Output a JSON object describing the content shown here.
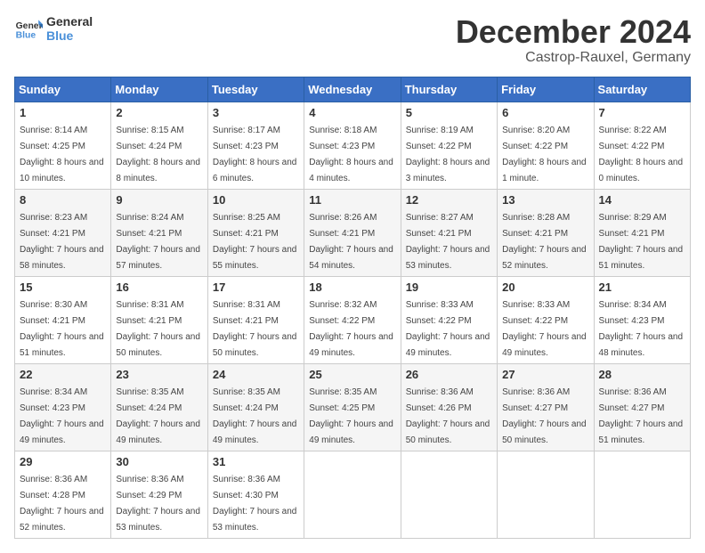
{
  "header": {
    "logo_general": "General",
    "logo_blue": "Blue",
    "month_title": "December 2024",
    "location": "Castrop-Rauxel, Germany"
  },
  "calendar": {
    "days_of_week": [
      "Sunday",
      "Monday",
      "Tuesday",
      "Wednesday",
      "Thursday",
      "Friday",
      "Saturday"
    ],
    "weeks": [
      [
        null,
        {
          "day": "2",
          "sunrise": "8:15 AM",
          "sunset": "4:24 PM",
          "daylight": "8 hours and 8 minutes."
        },
        {
          "day": "3",
          "sunrise": "8:17 AM",
          "sunset": "4:23 PM",
          "daylight": "8 hours and 6 minutes."
        },
        {
          "day": "4",
          "sunrise": "8:18 AM",
          "sunset": "4:23 PM",
          "daylight": "8 hours and 4 minutes."
        },
        {
          "day": "5",
          "sunrise": "8:19 AM",
          "sunset": "4:22 PM",
          "daylight": "8 hours and 3 minutes."
        },
        {
          "day": "6",
          "sunrise": "8:20 AM",
          "sunset": "4:22 PM",
          "daylight": "8 hours and 1 minute."
        },
        {
          "day": "7",
          "sunrise": "8:22 AM",
          "sunset": "4:22 PM",
          "daylight": "8 hours and 0 minutes."
        }
      ],
      [
        {
          "day": "1",
          "sunrise": "8:14 AM",
          "sunset": "4:25 PM",
          "daylight": "8 hours and 10 minutes."
        },
        {
          "day": "8",
          "sunrise": "8:23 AM",
          "sunset": "4:21 PM",
          "daylight": "7 hours and 58 minutes."
        },
        {
          "day": "9",
          "sunrise": "8:24 AM",
          "sunset": "4:21 PM",
          "daylight": "7 hours and 57 minutes."
        },
        {
          "day": "10",
          "sunrise": "8:25 AM",
          "sunset": "4:21 PM",
          "daylight": "7 hours and 55 minutes."
        },
        {
          "day": "11",
          "sunrise": "8:26 AM",
          "sunset": "4:21 PM",
          "daylight": "7 hours and 54 minutes."
        },
        {
          "day": "12",
          "sunrise": "8:27 AM",
          "sunset": "4:21 PM",
          "daylight": "7 hours and 53 minutes."
        },
        {
          "day": "13",
          "sunrise": "8:28 AM",
          "sunset": "4:21 PM",
          "daylight": "7 hours and 52 minutes."
        }
      ],
      [
        {
          "day": "14",
          "sunrise": "8:29 AM",
          "sunset": "4:21 PM",
          "daylight": "7 hours and 51 minutes."
        },
        {
          "day": "15",
          "sunrise": "8:30 AM",
          "sunset": "4:21 PM",
          "daylight": "7 hours and 51 minutes."
        },
        {
          "day": "16",
          "sunrise": "8:31 AM",
          "sunset": "4:21 PM",
          "daylight": "7 hours and 50 minutes."
        },
        {
          "day": "17",
          "sunrise": "8:31 AM",
          "sunset": "4:21 PM",
          "daylight": "7 hours and 50 minutes."
        },
        {
          "day": "18",
          "sunrise": "8:32 AM",
          "sunset": "4:22 PM",
          "daylight": "7 hours and 49 minutes."
        },
        {
          "day": "19",
          "sunrise": "8:33 AM",
          "sunset": "4:22 PM",
          "daylight": "7 hours and 49 minutes."
        },
        {
          "day": "20",
          "sunrise": "8:33 AM",
          "sunset": "4:22 PM",
          "daylight": "7 hours and 49 minutes."
        }
      ],
      [
        {
          "day": "21",
          "sunrise": "8:34 AM",
          "sunset": "4:23 PM",
          "daylight": "7 hours and 48 minutes."
        },
        {
          "day": "22",
          "sunrise": "8:34 AM",
          "sunset": "4:23 PM",
          "daylight": "7 hours and 49 minutes."
        },
        {
          "day": "23",
          "sunrise": "8:35 AM",
          "sunset": "4:24 PM",
          "daylight": "7 hours and 49 minutes."
        },
        {
          "day": "24",
          "sunrise": "8:35 AM",
          "sunset": "4:24 PM",
          "daylight": "7 hours and 49 minutes."
        },
        {
          "day": "25",
          "sunrise": "8:35 AM",
          "sunset": "4:25 PM",
          "daylight": "7 hours and 49 minutes."
        },
        {
          "day": "26",
          "sunrise": "8:36 AM",
          "sunset": "4:26 PM",
          "daylight": "7 hours and 50 minutes."
        },
        {
          "day": "27",
          "sunrise": "8:36 AM",
          "sunset": "4:27 PM",
          "daylight": "7 hours and 50 minutes."
        }
      ],
      [
        {
          "day": "28",
          "sunrise": "8:36 AM",
          "sunset": "4:27 PM",
          "daylight": "7 hours and 51 minutes."
        },
        {
          "day": "29",
          "sunrise": "8:36 AM",
          "sunset": "4:28 PM",
          "daylight": "7 hours and 52 minutes."
        },
        {
          "day": "30",
          "sunrise": "8:36 AM",
          "sunset": "4:29 PM",
          "daylight": "7 hours and 53 minutes."
        },
        {
          "day": "31",
          "sunrise": "8:36 AM",
          "sunset": "4:30 PM",
          "daylight": "7 hours and 53 minutes."
        },
        null,
        null,
        null
      ]
    ]
  }
}
